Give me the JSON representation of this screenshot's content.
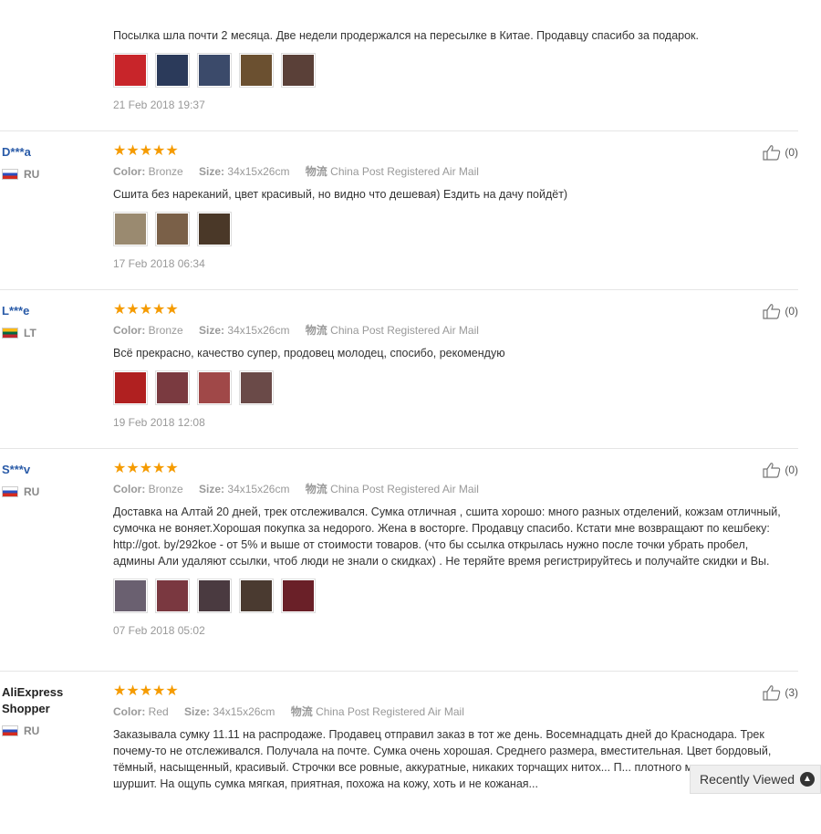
{
  "top": {
    "text": "Посылка шла почти 2 месяца. Две недели продержался на пересылке в Китае. Продавцу спасибо за подарок.",
    "date": "21 Feb 2018 19:37",
    "thumbs": [
      "#c8252a",
      "#2b3a5a",
      "#3b4a6a",
      "#6b5030",
      "#5a4038"
    ]
  },
  "reviews": [
    {
      "user": "D***a",
      "country": "RU",
      "flag": "ru",
      "stars": "★★★★★",
      "color_label": "Color:",
      "color": "Bronze",
      "size_label": "Size:",
      "size": "34x15x26cm",
      "ship_label": "物流",
      "shipping": "China Post Registered Air Mail",
      "text": "Сшита без нареканий, цвет красивый, но видно что дешевая) Ездить на дачу пойдёт)",
      "thumbs": [
        "#9a8a70",
        "#7a6048",
        "#4a3828"
      ],
      "date": "17 Feb 2018 06:34",
      "helpful": "(0)"
    },
    {
      "user": "L***e",
      "country": "LT",
      "flag": "lt",
      "stars": "★★★★★",
      "color_label": "Color:",
      "color": "Bronze",
      "size_label": "Size:",
      "size": "34x15x26cm",
      "ship_label": "物流",
      "shipping": "China Post Registered Air Mail",
      "text": "Всё прекрасно, качество супер, продовец молодец, спосибо, рекомендую",
      "thumbs": [
        "#b02020",
        "#7a3a40",
        "#a04848",
        "#6a4a48"
      ],
      "date": "19 Feb 2018 12:08",
      "helpful": "(0)"
    },
    {
      "user": "S***v",
      "country": "RU",
      "flag": "ru",
      "stars": "★★★★★",
      "color_label": "Color:",
      "color": "Bronze",
      "size_label": "Size:",
      "size": "34x15x26cm",
      "ship_label": "物流",
      "shipping": "China Post Registered Air Mail",
      "text": "Доставка на Алтай 20 дней, трек отслеживался. Сумка отличная , сшита хорошо: много разных отделений, кожзам отличный, сумочка не воняет.Хорошая покупка за недорого. Жена в восторге. Продавцу спасибо. Кстати мне возвращают по кешбеку: http://got. by/292koe - от 5% и выше от стоимости товаров. (что бы ссылка открылась нужно после точки убрать пробел, админы Али удаляют ссылки, чтоб люди не знали о скидках) . Не теряйте время регистрируйтесь и получайте скидки и Вы.",
      "thumbs": [
        "#6a6070",
        "#7a3840",
        "#4a3a40",
        "#4a3a30",
        "#6a2028"
      ],
      "date": "07 Feb 2018 05:02",
      "helpful": "(0)"
    },
    {
      "user": "AliExpress Shopper",
      "country": "RU",
      "flag": "ru",
      "stars": "★★★★★",
      "color_label": "Color:",
      "color": "Red",
      "size_label": "Size:",
      "size": "34x15x26cm",
      "ship_label": "物流",
      "shipping": "China Post Registered Air Mail",
      "text": "Заказывала сумку 11.11 на распродаже. Продавец отправил заказ в тот же день. Восемнадцать дней до Краснодара. Трек почему-то не отслеживался. Получала на почте. Сумка очень хорошая. Среднего размера, вместительная. Цвет бордовый, тёмный, насыщенный, красивый. Строчки все ровные, аккуратные, никаких торчащих нитох... П... плотного материала,не шуршит. На ощупь сумка мягкая, приятная, похожа на кожу, хоть и не кожаная...",
      "thumbs": [],
      "date": "",
      "helpful": "(3)"
    }
  ],
  "recent": {
    "label": "Recently Viewed",
    "icon": "chevron-up-icon"
  }
}
